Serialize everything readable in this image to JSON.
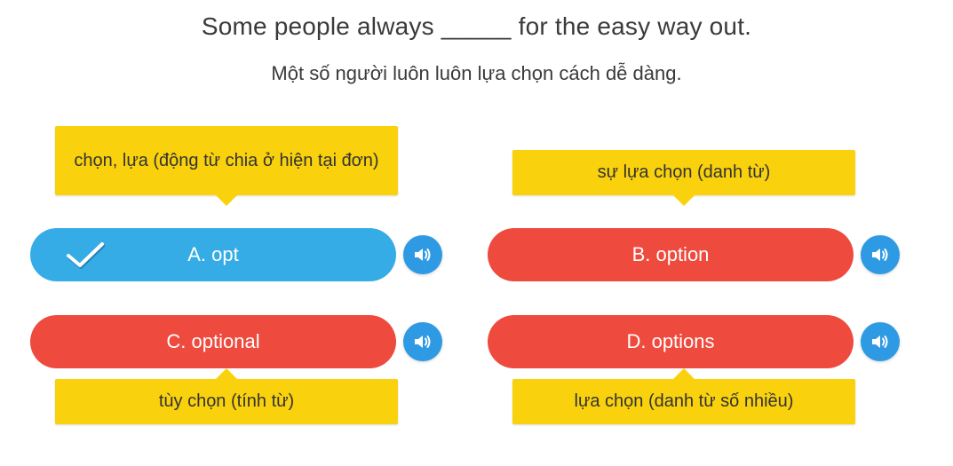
{
  "question": {
    "sentence": "Some people always _____ for the easy way out.",
    "translation": "Một số người luôn luôn lựa chọn cách dễ dàng."
  },
  "options": [
    {
      "label": "A. opt",
      "hint": "chọn, lựa (động từ chia ở hiện tại đơn)",
      "state": "selected",
      "color": "#35ace5"
    },
    {
      "label": "B. option",
      "hint": "sự lựa chọn (danh từ)",
      "state": "wrong",
      "color": "#ee4a3e"
    },
    {
      "label": "C. optional",
      "hint": "tùy chọn (tính từ)",
      "state": "wrong",
      "color": "#ee4a3e"
    },
    {
      "label": "D. options",
      "hint": "lựa chọn (danh từ số nhiều)",
      "state": "wrong",
      "color": "#ee4a3e"
    }
  ],
  "icons": {
    "audio": "speaker-icon",
    "selected": "checkmark-icon"
  },
  "colors": {
    "hint_background": "#f9d10d",
    "correct": "#35ace5",
    "wrong": "#ee4a3e",
    "audio_button": "#2e9ae3"
  }
}
